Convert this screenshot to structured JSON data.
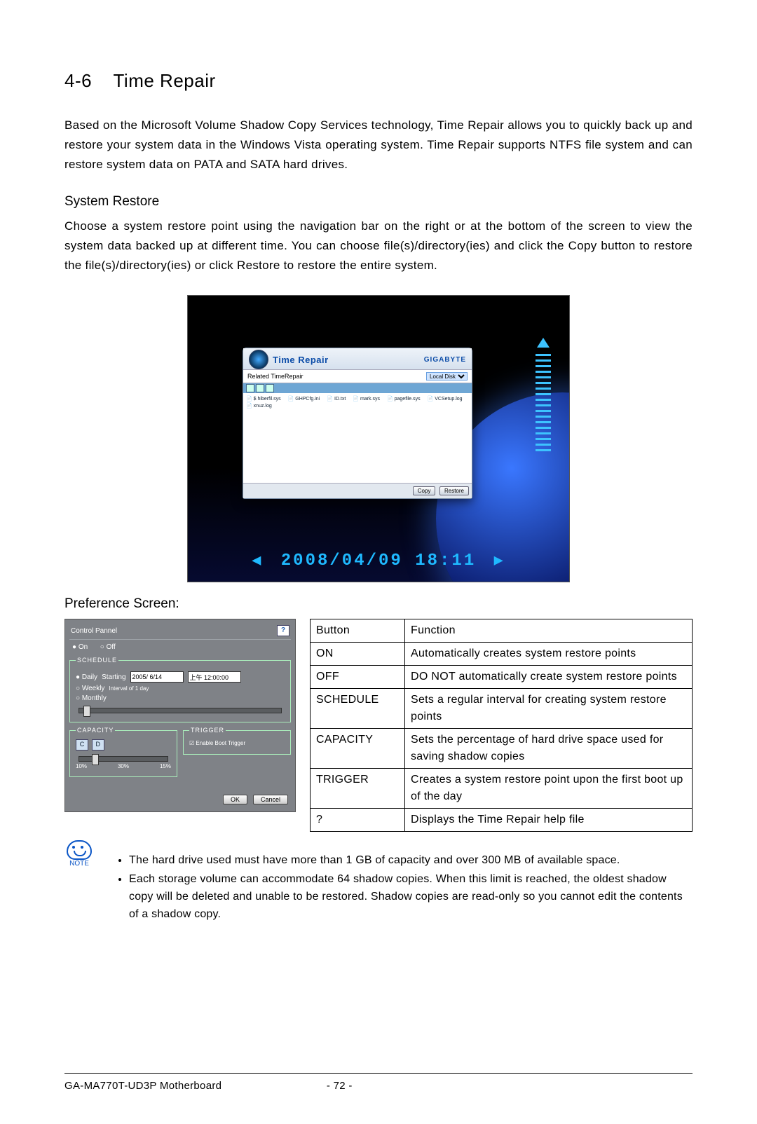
{
  "section": {
    "number": "4-6",
    "title": "Time Repair"
  },
  "intro": "Based on the Microsoft Volume Shadow Copy Services technology, Time Repair allows you to quickly back up and restore your system data in the Windows Vista operating system. Time Repair supports NTFS file system and can restore system data on PATA and SATA hard drives.",
  "system_restore": {
    "heading": "System Restore",
    "para_a": "Choose a system restore point using the navigation bar on the right or at the bottom of the screen to view the system data backed up at different time. You can choose file(s)/directory(ies) and click the ",
    "copy_word": "Copy",
    "para_b": " button to restore the file(s)/directory(ies) or click ",
    "restore_word": "Restore",
    "para_c": " to restore the entire system."
  },
  "screenshot": {
    "app_title": "Time Repair",
    "brand": "GIGABYTE",
    "crumb": "Related TimeRepair",
    "dropdown": "Local Disk",
    "files": [
      "$ hiberfil.sys",
      "GHPCfg.ini",
      "ID.txt",
      "mark.sys",
      "pagefile.sys",
      "VCSetup.log",
      "xnuz.log"
    ],
    "btn_copy": "Copy",
    "btn_restore": "Restore",
    "datetime": "2008/04/09  18:11"
  },
  "preference": {
    "heading": "Preference Screen:",
    "control_panel": "Control Pannel",
    "on": "On",
    "off": "Off",
    "help": "?",
    "schedule_legend": "SCHEDULE",
    "daily": "Daily",
    "weekly": "Weekly",
    "monthly": "Monthly",
    "starting": "Starting",
    "date_val": "2005/ 6/14",
    "time_val": "上午 12:00:00",
    "interval": "Interval of 1   day",
    "capacity_legend": "CAPACITY",
    "drives": [
      "C",
      "D"
    ],
    "pct10": "10%",
    "pct30": "30%",
    "pct_val": "15%",
    "trigger_legend": "TRIGGER",
    "trigger_check": "Enable Boot Trigger",
    "ok": "OK",
    "cancel": "Cancel"
  },
  "func_table": {
    "h1": "Button",
    "h2": "Function",
    "rows": [
      {
        "b": "ON",
        "f": "Automatically creates system restore points"
      },
      {
        "b": "OFF",
        "f": "DO NOT automatically create system restore points"
      },
      {
        "b": "SCHEDULE",
        "f": "Sets a regular interval for creating system restore points"
      },
      {
        "b": "CAPACITY",
        "f": "Sets the percentage of hard drive space used for saving shadow copies"
      },
      {
        "b": "TRIGGER",
        "f": "Creates a system restore point upon the first boot up of the day"
      },
      {
        "b": "?",
        "f": "Displays the Time Repair help file"
      }
    ]
  },
  "notes": {
    "label": "NOTE",
    "items": [
      "The hard drive used must have more than 1 GB of capacity and over 300 MB of available space.",
      "Each storage volume can accommodate 64 shadow copies. When this limit is reached, the oldest shadow copy will be deleted and unable to be restored. Shadow copies are read-only so you cannot edit the contents of a shadow copy."
    ]
  },
  "footer": {
    "model": "GA-MA770T-UD3P Motherboard",
    "page": "- 72 -"
  }
}
